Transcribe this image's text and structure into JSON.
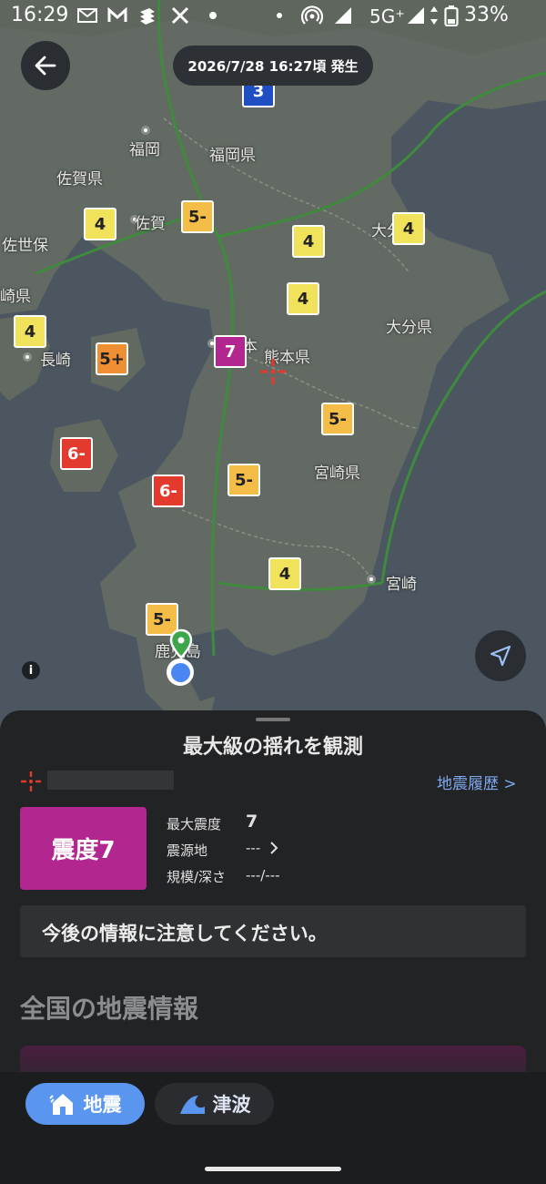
{
  "status_bar": {
    "time": "16:29",
    "network": "5G⁺",
    "battery": "33%",
    "icons": [
      "gmail-icon",
      "mail-m-icon",
      "app-icon",
      "x-icon",
      "dot-icon",
      "hotspot-icon",
      "signal-icon",
      "battery-icon"
    ]
  },
  "header": {
    "back_icon": "arrow-left-icon",
    "occurred_at": "2026/7/28 16:27頃 発生"
  },
  "map": {
    "place_labels": {
      "fukuoka_city": "福岡",
      "fukuoka_pref": "福岡県",
      "saga_pref": "佐賀県",
      "saga_city": "佐賀",
      "sasebo": "佐世保",
      "nagasaki_pref": "崎県",
      "nagasaki_city": "長崎",
      "kumamoto_pref": "熊本県",
      "oita_pref": "大分県",
      "oita_city": "大分",
      "miyazaki_pref": "宮崎県",
      "miyazaki_city": "宮崎",
      "kagoshima": "鹿児島",
      "kumamoto_city": "本"
    },
    "intensity_markers": [
      {
        "label": "3"
      },
      {
        "label": "4"
      },
      {
        "label": "5-"
      },
      {
        "label": "4"
      },
      {
        "label": "4"
      },
      {
        "label": "4"
      },
      {
        "label": "4"
      },
      {
        "label": "5+"
      },
      {
        "label": "7"
      },
      {
        "label": "5-"
      },
      {
        "label": "6-"
      },
      {
        "label": "6-"
      },
      {
        "label": "5-"
      },
      {
        "label": "4"
      },
      {
        "label": "5-"
      }
    ],
    "intensity_colors": {
      "3": "#1f4fc2",
      "4": "#f0e25a",
      "5-": "#f3bd48",
      "5+": "#ee8f34",
      "6-": "#e23a2c",
      "7": "#b1268f"
    },
    "info_icon": "i",
    "locate_icon": "navigation-arrow-icon"
  },
  "summary": {
    "title": "最大級の揺れを観測",
    "history_link": "地震履歴 >",
    "intensity_badge": "震度7",
    "max_intensity_label": "最大震度",
    "max_intensity_value": "7",
    "epicenter_label": "震源地",
    "epicenter_value": "---",
    "magnitude_depth_label": "規模/深さ",
    "magnitude_depth_value": "---/---",
    "notice": "今後の情報に注意してください。",
    "national_title": "全国の地震情報"
  },
  "nav": {
    "quake_tab": "地震",
    "tsunami_tab": "津波"
  }
}
